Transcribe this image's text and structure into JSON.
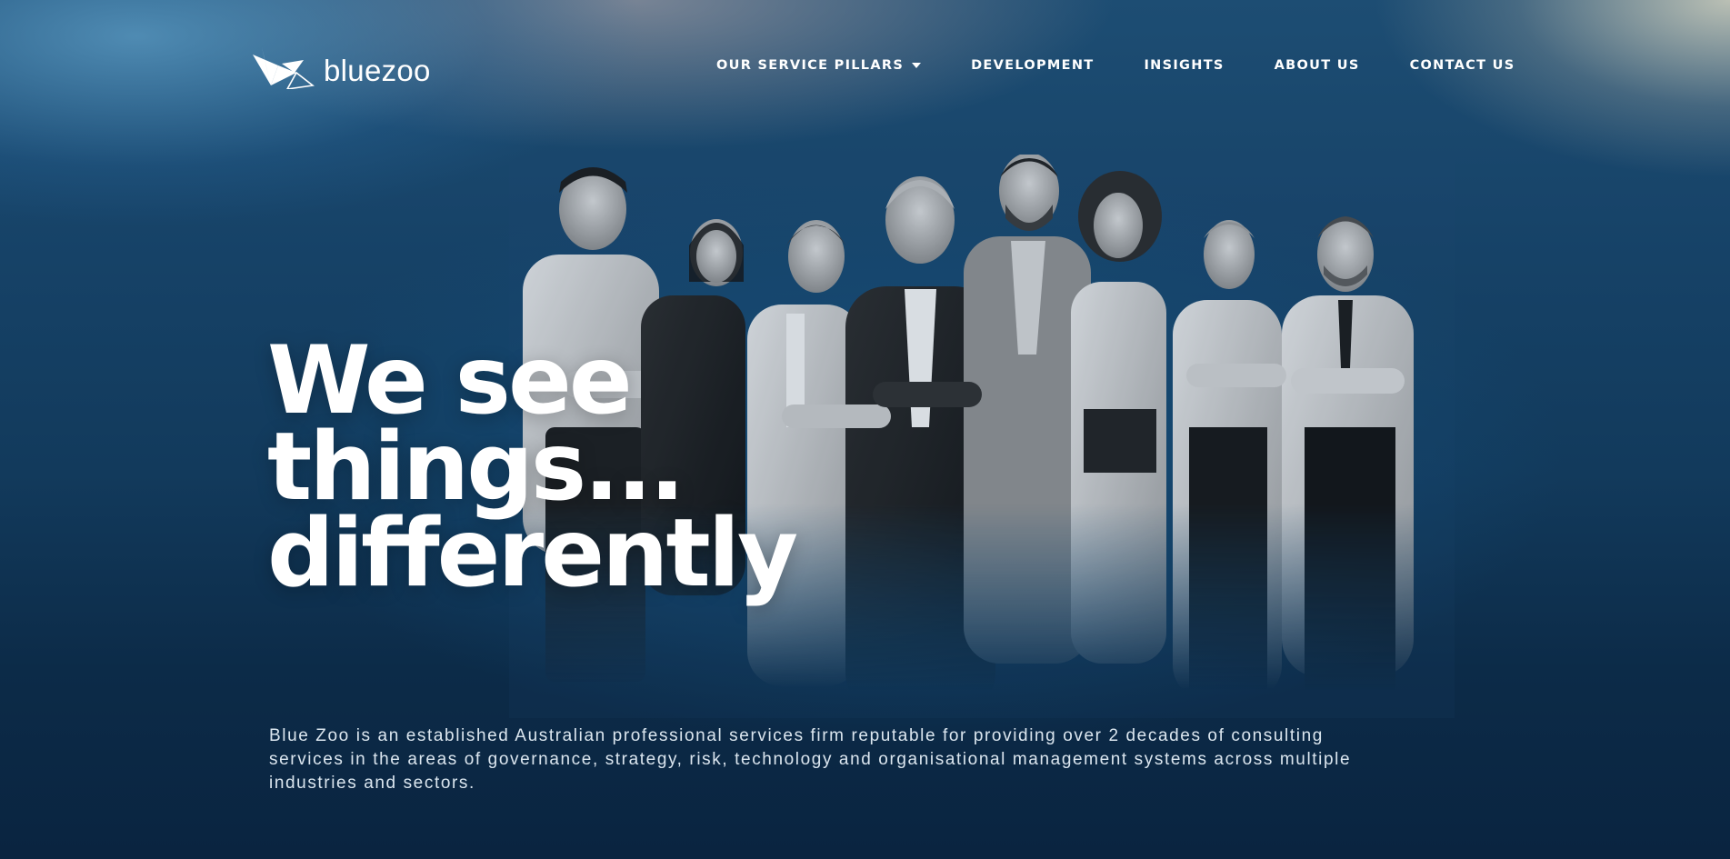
{
  "brand": {
    "name": "bluezoo",
    "logo_icon": "bluezoo-origami-logo-icon"
  },
  "nav": {
    "items": [
      {
        "label": "OUR SERVICE PILLARS",
        "has_dropdown": true
      },
      {
        "label": "DEVELOPMENT"
      },
      {
        "label": "INSIGHTS"
      },
      {
        "label": "ABOUT US"
      },
      {
        "label": "CONTACT US"
      }
    ],
    "dropdown_icon": "caret-down-icon"
  },
  "hero": {
    "headline_lines": [
      "We see",
      "things...",
      "differently"
    ],
    "description": "Blue Zoo is an established Australian professional services firm reputable for providing over 2 decades of consulting services in the areas of governance, strategy, risk, technology and organisational management systems across multiple industries and sectors.",
    "image": "team-photo"
  },
  "colors": {
    "background_dark": "#0d2a45",
    "background_blue": "#1d4d73",
    "text": "#ffffff",
    "muted_text": "#dbe6ef"
  }
}
